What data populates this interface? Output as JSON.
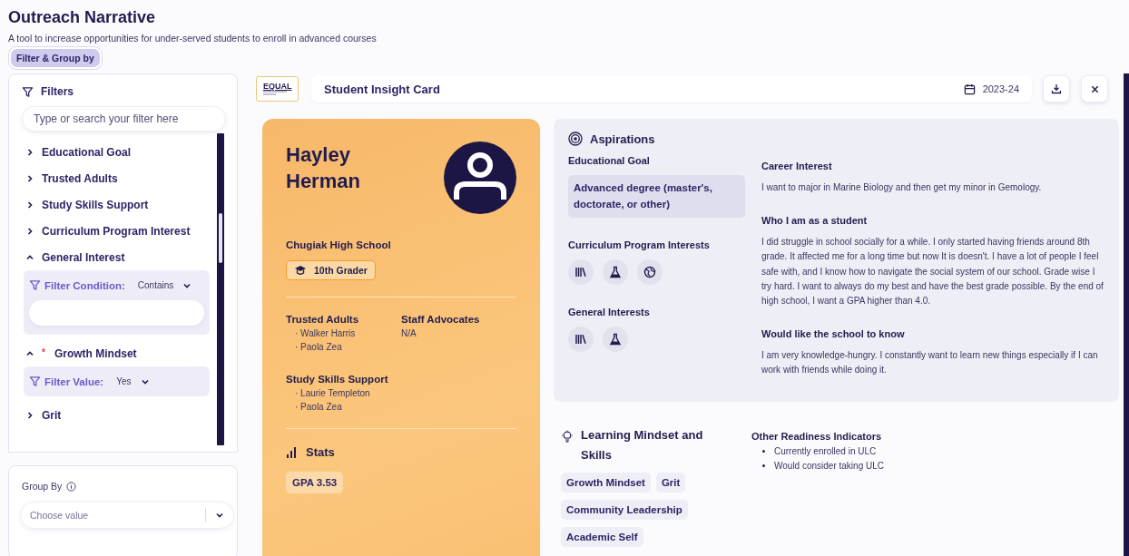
{
  "app": {
    "title": "Outreach Narrative",
    "subtitle": "A tool to increase opportunities for under-served students to enroll in advanced courses",
    "filter_group_button": "Filter & Group by"
  },
  "filters": {
    "heading": "Filters",
    "required_mark": "*",
    "search_placeholder": "Type or search your filter here",
    "items": [
      {
        "label": "Educational Goal",
        "expanded": false,
        "required": false
      },
      {
        "label": "Trusted Adults",
        "expanded": false,
        "required": false
      },
      {
        "label": "Study Skills Support",
        "expanded": false,
        "required": false
      },
      {
        "label": "Curriculum Program Interest",
        "expanded": false,
        "required": false
      },
      {
        "label": "General Interest",
        "expanded": true,
        "required": false,
        "panel": {
          "kind": "condition",
          "label": "Filter Condition:",
          "value": "Contains"
        }
      },
      {
        "label": "Growth Mindset",
        "expanded": true,
        "required": true,
        "panel": {
          "kind": "value",
          "label": "Filter Value:",
          "value": "Yes"
        }
      },
      {
        "label": "Grit",
        "expanded": false,
        "required": false
      }
    ]
  },
  "group_by": {
    "label": "Group By",
    "placeholder": "Choose value"
  },
  "card_header": {
    "logo": "EQUAL",
    "title": "Student Insight Card",
    "year": "2023-24"
  },
  "profile": {
    "name": "Hayley Herman",
    "school": "Chugiak High School",
    "grade": "10th Grader",
    "trusted_adults": {
      "heading": "Trusted Adults",
      "names": [
        "· Walker Harris",
        "· Paola Zea"
      ]
    },
    "staff_advocates": {
      "heading": "Staff Advocates",
      "value": "N/A"
    },
    "study_skills": {
      "heading": "Study Skills Support",
      "names": [
        "· Laurie Templeton",
        "· Paola Zea"
      ]
    },
    "stats": {
      "heading": "Stats",
      "gpa": "GPA 3.53"
    }
  },
  "aspirations": {
    "heading": "Aspirations",
    "educational_goal": {
      "heading": "Educational Goal",
      "value": "Advanced degree (master's, doctorate, or other)"
    },
    "curriculum_interests": {
      "heading": "Curriculum Program Interests",
      "items": [
        {
          "kind": "books"
        },
        {
          "kind": "flask"
        },
        {
          "kind": "globe"
        }
      ]
    },
    "general_interests": {
      "heading": "General Interests",
      "items": [
        {
          "kind": "books"
        },
        {
          "kind": "flask"
        }
      ]
    },
    "career_interest": {
      "heading": "Career Interest",
      "text": "I want to major in Marine Biology and then get my minor in Gemology."
    },
    "who_i_am": {
      "heading": "Who I am as a student",
      "text": "I did struggle in school socially for a while. I only started having friends around 8th grade. It affected me for a long time but now It is doesn't. I have a lot of people I feel safe with, and I know how to navigate the social system of our school. Grade wise I try hard. I want to always do my best and have the best grade possible. By the end of high school, I want a GPA higher than 4.0."
    },
    "would_like": {
      "heading": "Would like the school to know",
      "text": "I am very knowledge-hungry. I constantly want to learn new things especially if I can work with friends while doing it."
    }
  },
  "mindset": {
    "heading": "Learning Mindset and Skills",
    "tags": [
      "Growth Mindset",
      "Grit",
      "Community Leadership",
      "Academic Self"
    ]
  },
  "readiness": {
    "heading": "Other Readiness Indicators",
    "items": [
      "Currently enrolled in ULC",
      "Would consider taking ULC"
    ]
  }
}
